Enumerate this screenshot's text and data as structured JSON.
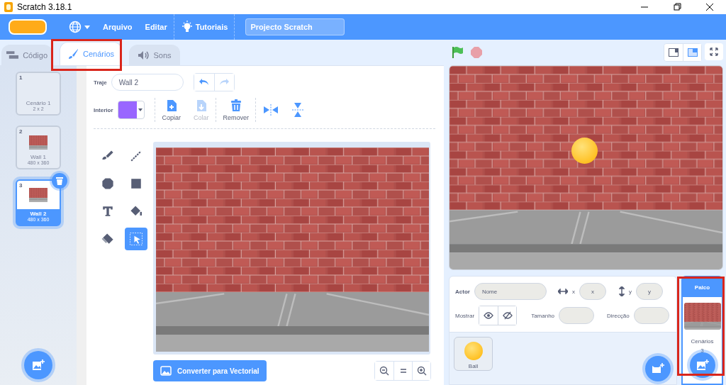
{
  "window": {
    "title": "Scratch 3.18.1"
  },
  "menu_bar": {
    "items": [
      "Arquivo",
      "Editar"
    ],
    "tutorials": "Tutoriais",
    "project_title": "Projecto Scratch"
  },
  "tabs": [
    {
      "label": "Código",
      "kind": "code",
      "selected": false
    },
    {
      "label": "Cenários",
      "kind": "costumes",
      "selected": true
    },
    {
      "label": "Sons",
      "kind": "sounds",
      "selected": false
    }
  ],
  "costumes": [
    {
      "number": "1",
      "name": "Cenário 1",
      "size": "2 x 2",
      "kind": "blank",
      "selected": false
    },
    {
      "number": "2",
      "name": "Wall 1",
      "size": "480 x 360",
      "kind": "wall",
      "selected": false
    },
    {
      "number": "3",
      "name": "Wall 2",
      "size": "480 x 360",
      "kind": "wall",
      "selected": true
    }
  ],
  "editor": {
    "costume_label": "Traje",
    "costume_name": "Wall 2",
    "fill_label": "Interior",
    "actions": [
      {
        "label": "Copiar",
        "kind": "copy",
        "disabled": false
      },
      {
        "label": "Colar",
        "kind": "paste",
        "disabled": true
      },
      {
        "label": "Remover",
        "kind": "delete",
        "disabled": false
      }
    ],
    "tools": [
      {
        "kind": "brush",
        "selected": false
      },
      {
        "kind": "line",
        "selected": false
      },
      {
        "kind": "circle",
        "selected": false
      },
      {
        "kind": "rect",
        "selected": false
      },
      {
        "kind": "text",
        "selected": false
      },
      {
        "kind": "fill",
        "selected": false
      },
      {
        "kind": "eraser",
        "selected": false
      },
      {
        "kind": "select",
        "selected": true
      }
    ],
    "convert_button": "Converter para Vectorial"
  },
  "sprite_info": {
    "actor_label": "Actor",
    "name_placeholder": "Nome",
    "x_label": "x",
    "x_placeholder": "x",
    "y_label": "y",
    "y_placeholder": "y",
    "show_label": "Mostrar",
    "size_label": "Tamanho",
    "direction_label": "Direcção"
  },
  "sprites": [
    {
      "name": "Ball",
      "selected": false
    }
  ],
  "stage_selector": {
    "title": "Palco",
    "backdrops_label": "Cenários",
    "backdrops_count": "3"
  }
}
